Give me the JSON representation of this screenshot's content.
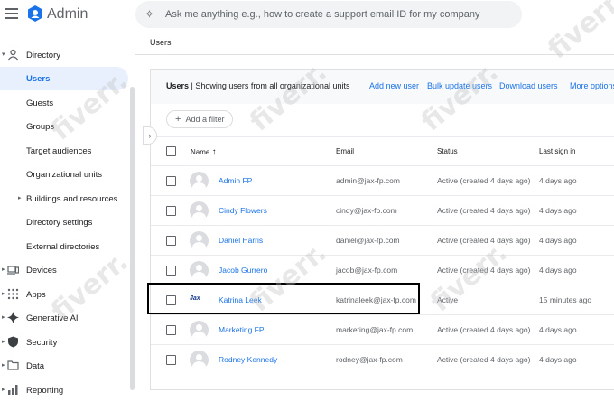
{
  "app": {
    "title": "Admin"
  },
  "search": {
    "placeholder": "Ask me anything e.g., how to create a support email ID for my company"
  },
  "breadcrumb": "Users",
  "sidebar": {
    "items": [
      {
        "label": "Directory",
        "icon": "person-icon"
      },
      {
        "label": "Users",
        "active": true
      },
      {
        "label": "Guests"
      },
      {
        "label": "Groups"
      },
      {
        "label": "Target audiences"
      },
      {
        "label": "Organizational units"
      },
      {
        "label": "Buildings and resources"
      },
      {
        "label": "Directory settings"
      },
      {
        "label": "External directories"
      },
      {
        "label": "Devices",
        "icon": "devices-icon"
      },
      {
        "label": "Apps",
        "icon": "apps-grid-icon"
      },
      {
        "label": "Generative AI",
        "icon": "sparkle-icon"
      },
      {
        "label": "Security",
        "icon": "shield-icon"
      },
      {
        "label": "Data",
        "icon": "folder-icon"
      },
      {
        "label": "Reporting",
        "icon": "chart-icon"
      }
    ]
  },
  "users_panel": {
    "title_bold": "Users",
    "title_rest": " | Showing users from all organizational units",
    "actions": [
      "Add new user",
      "Bulk update users",
      "Download users",
      "More options"
    ],
    "filter_label": "Add a filter",
    "columns": {
      "name": "Name",
      "email": "Email",
      "status": "Status",
      "last_sign_in": "Last sign in"
    },
    "rows": [
      {
        "name": "Admin FP",
        "email": "admin@jax-fp.com",
        "status": "Active (created 4 days ago)",
        "last_sign_in": "4 days ago"
      },
      {
        "name": "Cindy Flowers",
        "email": "cindy@jax-fp.com",
        "status": "Active (created 4 days ago)",
        "last_sign_in": "4 days ago"
      },
      {
        "name": "Daniel Harris",
        "email": "daniel@jax-fp.com",
        "status": "Active (created 4 days ago)",
        "last_sign_in": "4 days ago"
      },
      {
        "name": "Jacob Gurrero",
        "email": "jacob@jax-fp.com",
        "status": "Active (created 4 days ago)",
        "last_sign_in": "4 days ago"
      },
      {
        "name": "Katrina Leek",
        "email": "katrinaleek@jax-fp.com",
        "status": "Active",
        "last_sign_in": "15 minutes ago",
        "avatar_text": "Jax"
      },
      {
        "name": "Marketing FP",
        "email": "marketing@jax-fp.com",
        "status": "Active (created 4 days ago)",
        "last_sign_in": "4 days ago"
      },
      {
        "name": "Rodney Kennedy",
        "email": "rodney@jax-fp.com",
        "status": "Active (created 4 days ago)",
        "last_sign_in": "4 days ago"
      }
    ]
  },
  "watermark": "fiverr.",
  "colors": {
    "accent": "#1a73e8",
    "active_nav_bg": "#e8f0fe"
  }
}
